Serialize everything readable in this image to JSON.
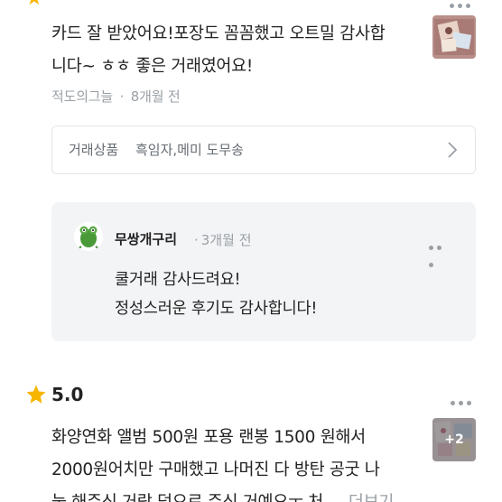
{
  "review1": {
    "text_line1": "카드 잘 받았어요!포장도 꼼꼼했고 오트밀 감사합",
    "text_line2": "니다~ ㅎㅎ 좋은 거래였어요!",
    "reviewer": "적도의그늘",
    "separator": "·",
    "time": "8개월 전"
  },
  "product": {
    "label": "거래상품",
    "name": "흑임자,메미 도무송"
  },
  "reply": {
    "name": "무쌍개구리",
    "separator": "·",
    "time": "3개월 전",
    "line1": "쿨거래 감사드려요!",
    "line2": "정성스러운 후기도 감사합니다!"
  },
  "review2": {
    "rating": "5.0",
    "text_line1": "화양연화 앨범 500원 포용 랜봉 1500 원해서",
    "text_line2": "2000원어치만 구매했고 나머진 다 방탄 공굿 나",
    "text_line3": "눔 해주신 거랑 덤으로 주신 거예요ㅜ 처 ...",
    "more_label": "더보기",
    "extra_photos": "+2"
  },
  "icons": {
    "star": "star-icon",
    "more": "more-dots-icon",
    "chevron": "chevron-right-icon"
  },
  "colors": {
    "star": "#f7b500",
    "meta": "#9aa0a6",
    "reply_bg": "#f3f4f6"
  }
}
